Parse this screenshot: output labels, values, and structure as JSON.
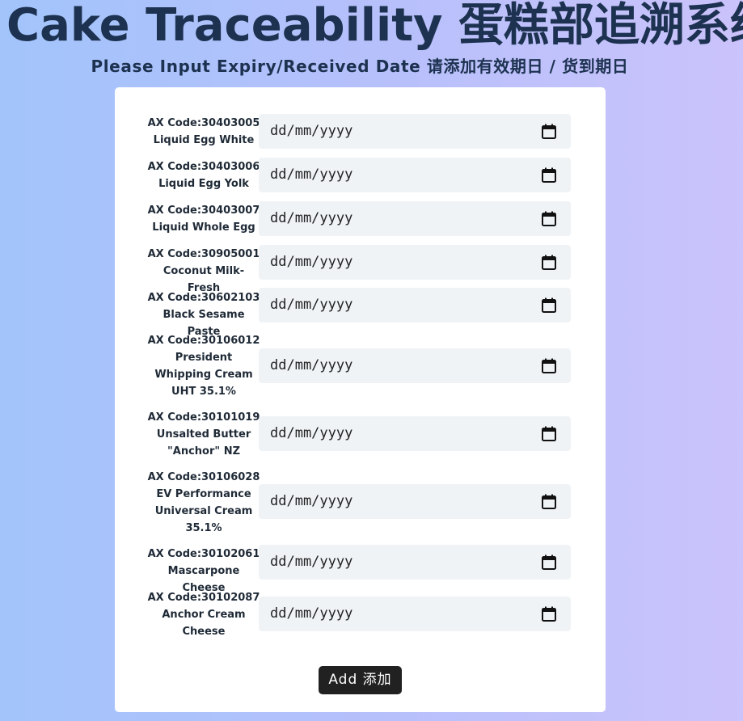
{
  "header": {
    "title": "Cake Traceability 蛋糕部追溯系统",
    "subtitle": "Please Input Expiry/Received Date 请添加有效期日 / 货到期日"
  },
  "form": {
    "date_placeholder": "dd/mm/yyyy",
    "items": [
      {
        "code": "AX Code:30403005",
        "name_lines": [
          "Liquid Egg White"
        ]
      },
      {
        "code": "AX Code:30403006",
        "name_lines": [
          "Liquid Egg Yolk"
        ]
      },
      {
        "code": "AX Code:30403007",
        "name_lines": [
          "Liquid Whole Egg"
        ]
      },
      {
        "code": "AX Code:30905001",
        "name_lines": [
          "Coconut Milk-Fresh"
        ]
      },
      {
        "code": "AX Code:30602103",
        "name_lines": [
          "Black Sesame Paste"
        ]
      },
      {
        "code": "AX Code:30106012",
        "name_lines": [
          "President",
          "Whipping Cream",
          "UHT 35.1%"
        ]
      },
      {
        "code": "AX Code:30101019",
        "name_lines": [
          "Unsalted Butter",
          "\"Anchor\" NZ"
        ]
      },
      {
        "code": "AX Code:30106028",
        "name_lines": [
          "EV Performance",
          "Universal Cream",
          "35.1%"
        ]
      },
      {
        "code": "AX Code:30102061",
        "name_lines": [
          "Mascarpone Cheese"
        ]
      },
      {
        "code": "AX Code:30102087",
        "name_lines": [
          "Anchor Cream",
          "Cheese"
        ]
      }
    ],
    "add_button_label": "Add 添加"
  },
  "icons": {
    "calendar": "calendar-icon"
  },
  "colors": {
    "title": "#1d3250",
    "button_bg": "#212121",
    "input_bg": "#f0f3f6"
  }
}
